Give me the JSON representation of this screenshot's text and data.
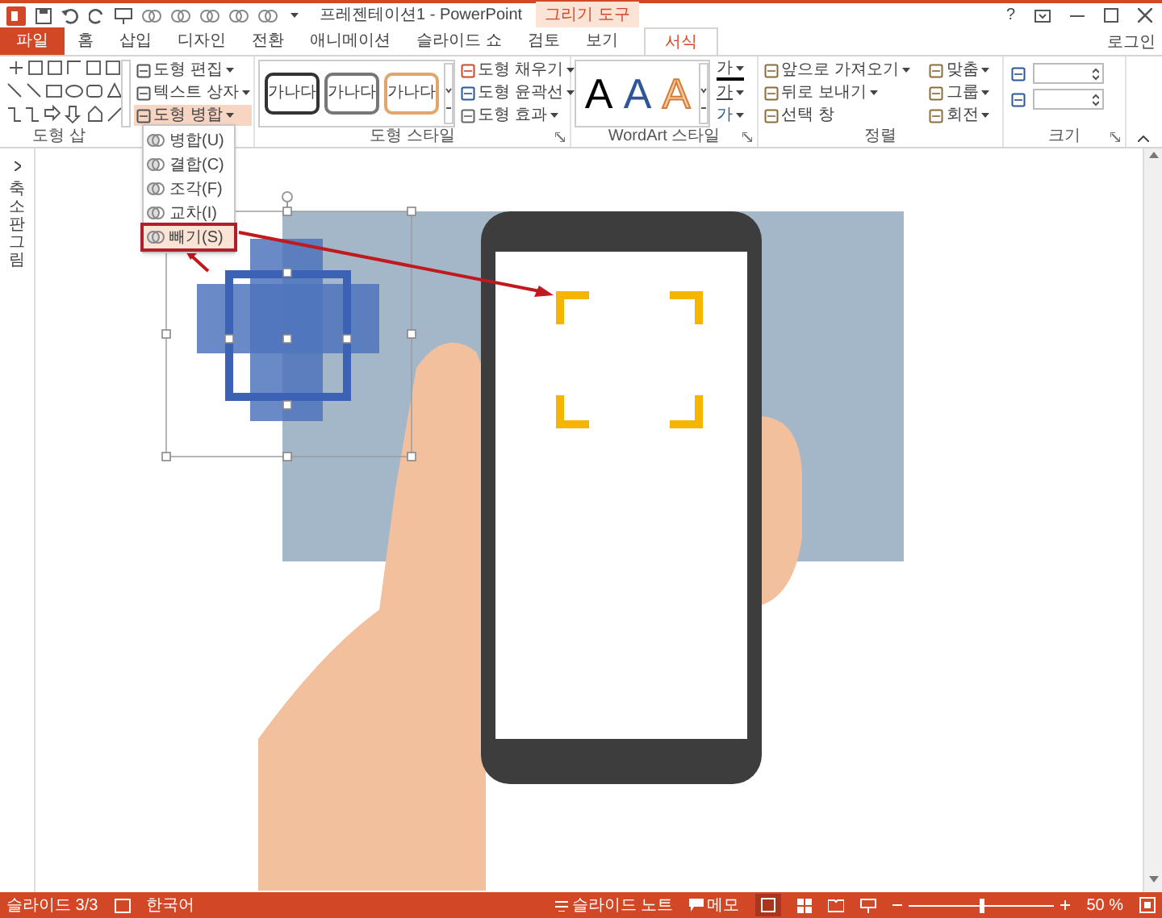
{
  "window": {
    "title": "프레젠테이션1 - PowerPoint",
    "context_tab": "그리기 도구",
    "help": "?"
  },
  "tabs": [
    {
      "label": "파일",
      "kind": "file",
      "selected": false
    },
    {
      "label": "홈",
      "kind": "tab",
      "selected": false
    },
    {
      "label": "삽입",
      "kind": "tab",
      "selected": false
    },
    {
      "label": "디자인",
      "kind": "tab",
      "selected": false
    },
    {
      "label": "전환",
      "kind": "tab",
      "selected": false
    },
    {
      "label": "애니메이션",
      "kind": "tab",
      "selected": false
    },
    {
      "label": "슬라이드 쇼",
      "kind": "tab",
      "selected": false
    },
    {
      "label": "검토",
      "kind": "tab",
      "selected": false
    },
    {
      "label": "보기",
      "kind": "tab",
      "selected": false
    },
    {
      "label": "서식",
      "kind": "tab",
      "selected": true
    }
  ],
  "sign_in": "로그인",
  "ribbon": {
    "insert_shapes": {
      "label": "도형 삽",
      "commands": [
        {
          "label": "도형 편집",
          "selected": false
        },
        {
          "label": "텍스트 상자",
          "selected": false
        },
        {
          "label": "도형 병합",
          "selected": true
        }
      ]
    },
    "shape_styles": {
      "label": "도형 스타일",
      "presets": [
        "가나다",
        "가나다",
        "가나다"
      ],
      "commands": [
        "도형 채우기",
        "도형 윤곽선",
        "도형 효과"
      ]
    },
    "wordart": {
      "label": "WordArt 스타일",
      "presets": [
        "A",
        "A",
        "A"
      ],
      "commands": [
        "가",
        "가",
        "가"
      ]
    },
    "arrange": {
      "label": "정렬",
      "commands": [
        "앞으로 가져오기",
        "뒤로 보내기",
        "선택 창",
        "맞춤",
        "그룹",
        "회전"
      ]
    },
    "size": {
      "label": "크기"
    }
  },
  "merge_menu": [
    {
      "label": "병합(U)",
      "selected": false
    },
    {
      "label": "결합(C)",
      "selected": false
    },
    {
      "label": "조각(F)",
      "selected": false
    },
    {
      "label": "교차(I)",
      "selected": false
    },
    {
      "label": "빼기(S)",
      "selected": true
    }
  ],
  "thumbnail_pane": {
    "label": "축소판 그림"
  },
  "status_bar": {
    "slide": "슬라이드 3/3",
    "language": "한국어",
    "notes": "슬라이드 노트",
    "comments": "메모",
    "zoom": "50 %",
    "zoom_slider": {
      "level": 0.5
    }
  }
}
